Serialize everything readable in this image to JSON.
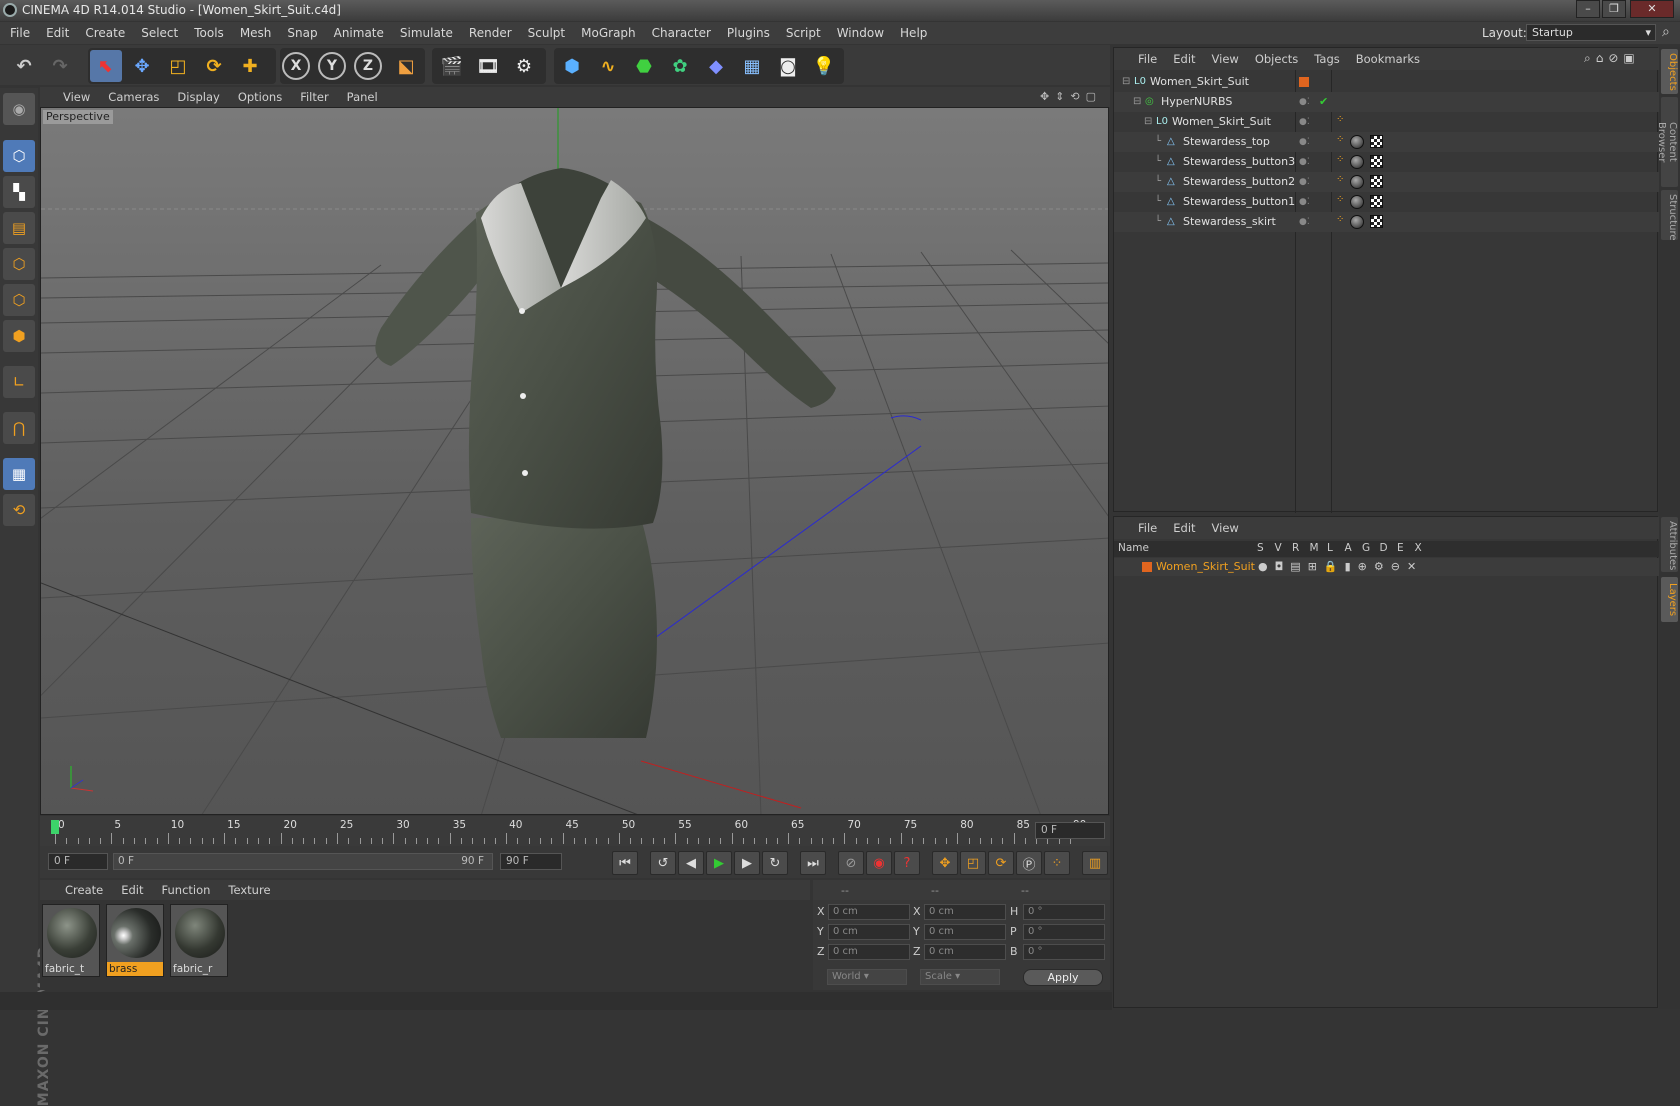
{
  "window": {
    "title": "CINEMA 4D R14.014 Studio - [Women_Skirt_Suit.c4d]"
  },
  "menu": [
    "File",
    "Edit",
    "Create",
    "Select",
    "Tools",
    "Mesh",
    "Snap",
    "Animate",
    "Simulate",
    "Render",
    "Sculpt",
    "MoGraph",
    "Character",
    "Plugins",
    "Script",
    "Window",
    "Help"
  ],
  "layout": {
    "label": "Layout:",
    "value": "Startup"
  },
  "viewport": {
    "menu": [
      "View",
      "Cameras",
      "Display",
      "Options",
      "Filter",
      "Panel"
    ],
    "label": "Perspective"
  },
  "timeline": {
    "ticks": [
      "0",
      "5",
      "10",
      "15",
      "20",
      "25",
      "30",
      "35",
      "40",
      "45",
      "50",
      "55",
      "60",
      "65",
      "70",
      "75",
      "80",
      "85",
      "90"
    ],
    "frame_field": "0 F"
  },
  "transport": {
    "start": "0 F",
    "range_start": "0 F",
    "range_end": "90 F",
    "end": "90 F"
  },
  "materials": {
    "menu": [
      "Create",
      "Edit",
      "Function",
      "Texture"
    ],
    "items": [
      {
        "name": "fabric_t",
        "selected": false
      },
      {
        "name": "brass",
        "selected": true
      },
      {
        "name": "fabric_r",
        "selected": false
      }
    ]
  },
  "coords": {
    "headers": [
      "--",
      "--",
      "--"
    ],
    "rows": [
      {
        "a": "X",
        "av": "0 cm",
        "b": "X",
        "bv": "0 cm",
        "c": "H",
        "cv": "0 °"
      },
      {
        "a": "Y",
        "av": "0 cm",
        "b": "Y",
        "bv": "0 cm",
        "c": "P",
        "cv": "0 °"
      },
      {
        "a": "Z",
        "av": "0 cm",
        "b": "Z",
        "bv": "0 cm",
        "c": "B",
        "cv": "0 °"
      }
    ],
    "world": "World",
    "scale": "Scale",
    "apply": "Apply"
  },
  "objects": {
    "menu": [
      "File",
      "Edit",
      "View",
      "Objects",
      "Tags",
      "Bookmarks"
    ],
    "rows": [
      {
        "name": "Women_Skirt_Suit",
        "indent": 0
      },
      {
        "name": "HyperNURBS",
        "indent": 1
      },
      {
        "name": "Women_Skirt_Suit",
        "indent": 2
      },
      {
        "name": "Stewardess_top",
        "indent": 3
      },
      {
        "name": "Stewardess_button3",
        "indent": 3
      },
      {
        "name": "Stewardess_button2",
        "indent": 3
      },
      {
        "name": "Stewardess_button1",
        "indent": 3
      },
      {
        "name": "Stewardess_skirt",
        "indent": 3
      }
    ]
  },
  "layers": {
    "menu": [
      "File",
      "Edit",
      "View"
    ],
    "columns": [
      "Name",
      "S",
      "V",
      "R",
      "M",
      "L",
      "A",
      "G",
      "D",
      "E",
      "X"
    ],
    "rows": [
      {
        "name": "Women_Skirt_Suit"
      }
    ]
  },
  "sidetabs": [
    "Objects",
    "Content Browser",
    "Structure",
    "Attributes",
    "Layers"
  ],
  "colors": {
    "accent": "#f0a020",
    "select": "#4a7bd0"
  }
}
